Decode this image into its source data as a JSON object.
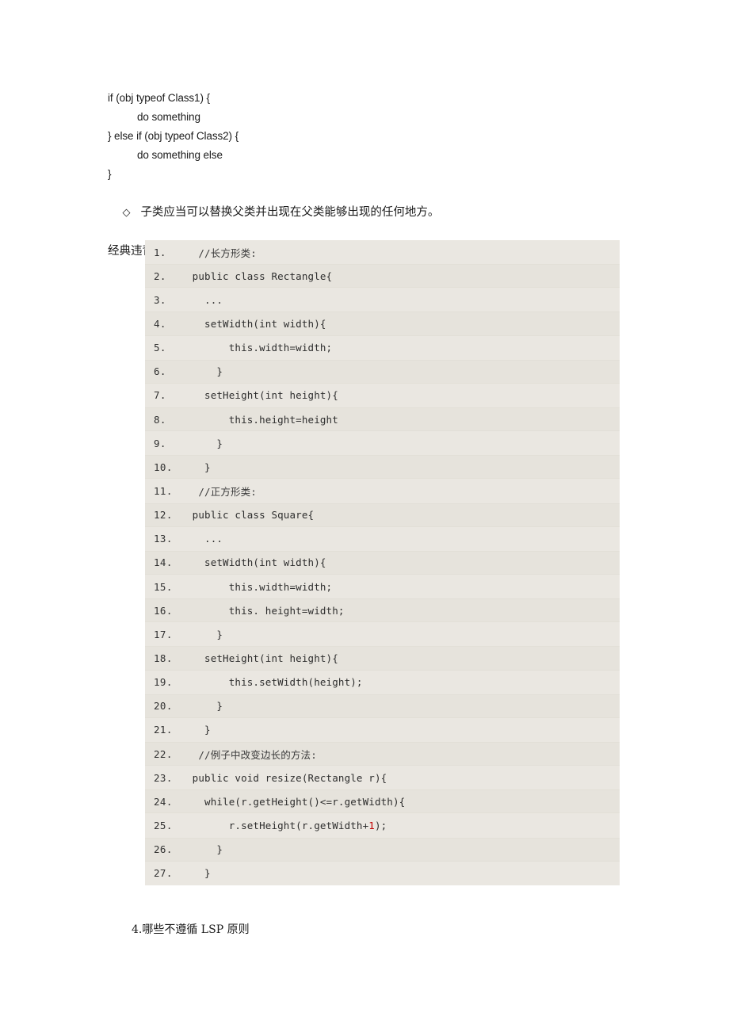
{
  "document": {
    "intro_code": [
      {
        "text": "if (obj typeof Class1) {",
        "indent": false
      },
      {
        "text": "do something",
        "indent": true
      },
      {
        "text": "} else if (obj typeof Class2) {",
        "indent": false
      },
      {
        "text": "do something else",
        "indent": true
      },
      {
        "text": "}",
        "indent": false
      }
    ],
    "bullet_glyph": "◇",
    "principle_text": "子类应当可以替换父类并出现在父类能够出现的任何地方。",
    "example_heading": "经典违背例子：长方形与正方形",
    "footer_text": "4.哪些不遵循 LSP 原则"
  },
  "code_listing": {
    "highlight_color": "#c00000",
    "background_color": "#e8e5de",
    "lines": [
      {
        "n": "1.",
        "code": "  //长方形类:",
        "cjk": true
      },
      {
        "n": "2.",
        "code": " public class Rectangle{",
        "cjk": false
      },
      {
        "n": "3.",
        "code": "   ...",
        "cjk": false
      },
      {
        "n": "4.",
        "code": "   setWidth(int width){",
        "cjk": false
      },
      {
        "n": "5.",
        "code": "       this.width=width;",
        "cjk": false
      },
      {
        "n": "6.",
        "code": "     }",
        "cjk": false
      },
      {
        "n": "7.",
        "code": "   setHeight(int height){",
        "cjk": false
      },
      {
        "n": "8.",
        "code": "       this.height=height",
        "cjk": false
      },
      {
        "n": "9.",
        "code": "     }",
        "cjk": false
      },
      {
        "n": "10.",
        "code": "   }",
        "cjk": false
      },
      {
        "n": "11.",
        "code": "  //正方形类:",
        "cjk": true
      },
      {
        "n": "12.",
        "code": " public class Square{",
        "cjk": false
      },
      {
        "n": "13.",
        "code": "   ...",
        "cjk": false
      },
      {
        "n": "14.",
        "code": "   setWidth(int width){",
        "cjk": false
      },
      {
        "n": "15.",
        "code": "       this.width=width;",
        "cjk": false
      },
      {
        "n": "16.",
        "code": "       this. height=width;",
        "cjk": false
      },
      {
        "n": "17.",
        "code": "     }",
        "cjk": false
      },
      {
        "n": "18.",
        "code": "   setHeight(int height){",
        "cjk": false
      },
      {
        "n": "19.",
        "code": "       this.setWidth(height);",
        "cjk": false
      },
      {
        "n": "20.",
        "code": "     }",
        "cjk": false
      },
      {
        "n": "21.",
        "code": "   }",
        "cjk": false
      },
      {
        "n": "22.",
        "code": "  //例子中改变边长的方法:",
        "cjk": true
      },
      {
        "n": "23.",
        "code": " public void resize(Rectangle r){",
        "cjk": false
      },
      {
        "n": "24.",
        "code": "   while(r.getHeight()<=r.getWidth){",
        "cjk": false
      },
      {
        "n": "25.",
        "code": "       r.setHeight(r.getWidth+",
        "code_hl": "1",
        "code_tail": ");",
        "cjk": false
      },
      {
        "n": "26.",
        "code": "     }",
        "cjk": false
      },
      {
        "n": "27.",
        "code": "   }",
        "cjk": false
      }
    ]
  }
}
